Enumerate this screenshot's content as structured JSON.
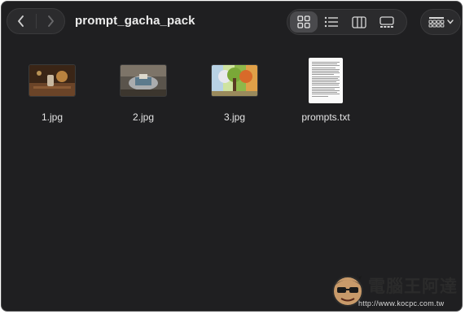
{
  "window": {
    "title": "prompt_gacha_pack"
  },
  "toolbar": {
    "back_icon": "chevron-left-icon",
    "forward_icon": "chevron-right-icon",
    "views": [
      {
        "name": "icon-view",
        "icon": "grid-icon",
        "active": true
      },
      {
        "name": "list-view",
        "icon": "list-icon",
        "active": false
      },
      {
        "name": "column-view",
        "icon": "columns-icon",
        "active": false
      },
      {
        "name": "gallery-view",
        "icon": "gallery-icon",
        "active": false
      }
    ],
    "group_icon": "group-by-icon"
  },
  "files": [
    {
      "name": "1.jpg",
      "kind": "image"
    },
    {
      "name": "2.jpg",
      "kind": "image"
    },
    {
      "name": "3.jpg",
      "kind": "image"
    },
    {
      "name": "prompts.txt",
      "kind": "text"
    }
  ],
  "watermark": {
    "text": "電腦王阿達",
    "url": "http://www.kocpc.com.tw"
  },
  "colors": {
    "background": "#1f1f21",
    "toolbar_control": "#2b2b2d",
    "active_view": "#4a4a4d",
    "text": "#ececec"
  }
}
